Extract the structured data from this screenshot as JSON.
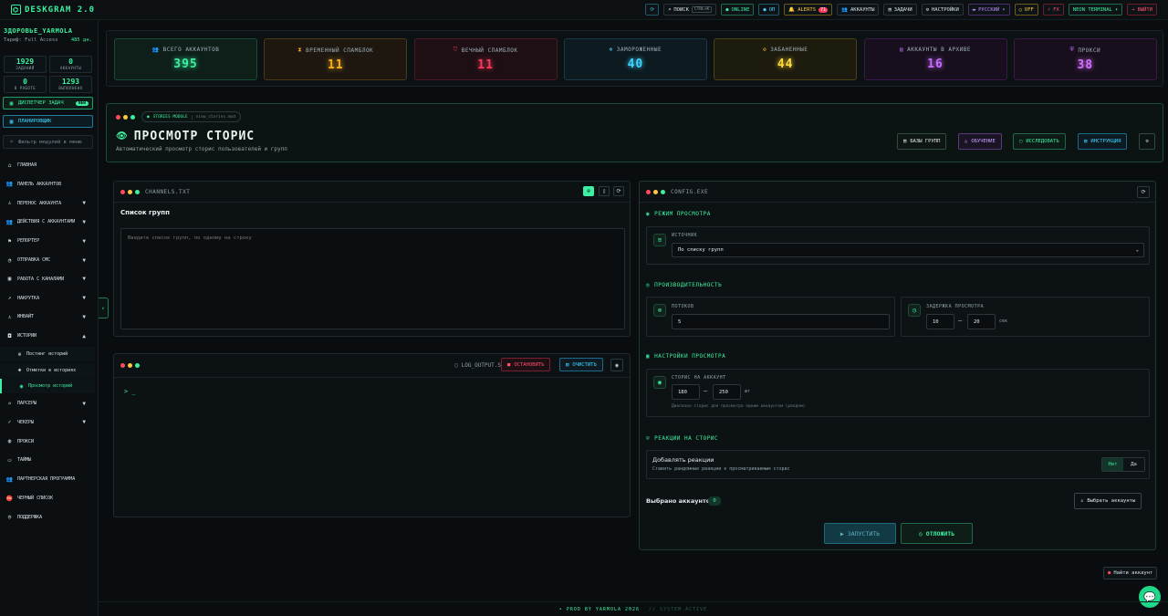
{
  "app": {
    "name": "DESKGRAM 2.0"
  },
  "topbar": {
    "search_label": "ПОИСК",
    "search_shortcut": "CTRL+K",
    "online_label": "ONLINE",
    "off_label": "ОП",
    "alerts_label": "ALERTS",
    "alerts_count": "71",
    "accounts_label": "АККАУНТЫ",
    "tasks_label": "ЗАДАЧИ",
    "settings_label": "НАСТРОЙКИ",
    "language_label": "РУССКИЙ",
    "mode_label": "OFF",
    "fx_label": "FX",
    "theme_label": "NEON TERMINAL",
    "logout_label": "ВЫЙТИ"
  },
  "sidebar": {
    "user_name": "ЗДОРОВЬЕ_YARMOLA",
    "tariff": "Тариф: Full Access",
    "balance": "485 дн.",
    "stats": [
      {
        "value": "1929",
        "label": "ЗАДАНИЙ"
      },
      {
        "value": "0",
        "label": "АККАУНТЫ"
      },
      {
        "value": "0",
        "label": "В РАБОТЕ"
      },
      {
        "value": "1293",
        "label": "ВЫПОЛНЕНО"
      }
    ],
    "task_manager": "ДИСПЕТЧЕР ЗАДАЧ",
    "task_manager_badge": "NEW",
    "scheduler": "ПЛАНИРОВЩИК",
    "filter_placeholder": "Фильтр модулей в меню",
    "nav": [
      {
        "label": "ГЛАВНАЯ",
        "icon": "home-icon",
        "chevron": ""
      },
      {
        "label": "ПАНЕЛЬ АККАУНТОВ",
        "icon": "users-icon",
        "chevron": ""
      },
      {
        "label": "ПЕРЕНОС АККАУНТА",
        "icon": "user-icon",
        "chevron": "▼"
      },
      {
        "label": "ДЕЙСТВИЯ С АККАУНТАМИ",
        "icon": "users-icon",
        "chevron": "▼"
      },
      {
        "label": "РЕПОРТЕР",
        "icon": "flag-icon",
        "chevron": "▼"
      },
      {
        "label": "ОТПРАВКА СМС",
        "icon": "chat-icon",
        "chevron": "▼"
      },
      {
        "label": "РАБОТА С КАНАЛАМИ",
        "icon": "channel-icon",
        "chevron": "▼"
      },
      {
        "label": "НАКРУТКА",
        "icon": "chart-icon",
        "chevron": "▼"
      },
      {
        "label": "ИНВАЙТ",
        "icon": "invite-icon",
        "chevron": "▼"
      },
      {
        "label": "ИСТОРИИ",
        "icon": "camera-icon",
        "chevron": "▲"
      }
    ],
    "sub_nav": [
      {
        "label": "Постинг историй",
        "icon": "plus-circle-icon"
      },
      {
        "label": "Отметки в историях",
        "icon": "tag-icon"
      },
      {
        "label": "Просмотр историй",
        "icon": "eye-icon"
      }
    ],
    "nav2": [
      {
        "label": "ПАРСЕРЫ",
        "icon": "search-icon",
        "chevron": "▼"
      },
      {
        "label": "ЧЕКЕРЫ",
        "icon": "check-icon",
        "chevron": "▼"
      },
      {
        "label": "ПРОКСИ",
        "icon": "globe-icon",
        "chevron": ""
      },
      {
        "label": "ТАЙМЫ",
        "icon": "clock-icon",
        "chevron": ""
      },
      {
        "label": "ПАРТНЕРСКАЯ ПРОГРАММА",
        "icon": "handshake-icon",
        "chevron": ""
      },
      {
        "label": "ЧЕРНЫЙ СПИСОК",
        "icon": "block-icon",
        "chevron": ""
      },
      {
        "label": "ПОДДЕРЖКА",
        "icon": "support-icon",
        "chevron": ""
      }
    ]
  },
  "stat_cards": [
    {
      "label": "ВСЕГО АККАУНТОВ",
      "value": "395",
      "color": "#3bf0a0",
      "bg": "#0e1f1a",
      "border": "#1a4a38",
      "icon": "👥"
    },
    {
      "label": "ВРЕМЕННЫЙ СПАМБЛОК",
      "value": "11",
      "color": "#ffb01a",
      "bg": "#1d1710",
      "border": "#4a3a1a",
      "icon": "⧗"
    },
    {
      "label": "ВЕЧНЫЙ СПАМБЛОК",
      "value": "11",
      "color": "#ff3a5c",
      "bg": "#1d0f14",
      "border": "#4a1a26",
      "icon": "⛉"
    },
    {
      "label": "ЗАМОРОЖЕННЫЕ",
      "value": "40",
      "color": "#3fd5ff",
      "bg": "#0d1a20",
      "border": "#1a3a4a",
      "icon": "❄"
    },
    {
      "label": "ЗАБАНЕННЫЕ",
      "value": "44",
      "color": "#ffd83c",
      "bg": "#1d1a0e",
      "border": "#4a421a",
      "icon": "⊘"
    },
    {
      "label": "АККАУНТЫ В АРХИВЕ",
      "value": "16",
      "color": "#c86cff",
      "bg": "#170f1d",
      "border": "#3a1a4a",
      "icon": "▤"
    },
    {
      "label": "ПРОКСИ",
      "value": "38",
      "color": "#d470ff",
      "bg": "#180f1c",
      "border": "#3a1a44",
      "icon": "⛨"
    }
  ],
  "hero": {
    "module_chip": "STORIES MODULE",
    "module_file": "view_stories.mod",
    "title": "ПРОСМОТР СТОРИС",
    "subtitle": "Автоматический просмотр сторис пользователей и групп",
    "btn_bases": "БАЗЫ ГРУПП",
    "btn_learn": "ОБУЧЕНИЕ",
    "btn_research": "ИССЛЕДОВАТЬ",
    "btn_instructions": "ИНСТРУКЦИЯ"
  },
  "channels": {
    "file": "CHANNELS.TXT",
    "heading": "Список групп",
    "placeholder": "Введите список групп, по одному на строку"
  },
  "log": {
    "file": "LOG_OUTPUT.SH",
    "stop": "ОСТАНОВИТЬ",
    "clear": "ОЧИСТИТЬ",
    "prompt": "> _"
  },
  "config": {
    "file": "CONFIG.EXE",
    "view_mode_title": "РЕЖИМ ПРОСМОТРА",
    "source_label": "ИСТОЧНИК",
    "source_value": "По списку групп",
    "perf_title": "ПРОИЗВОДИТЕЛЬНОСТЬ",
    "threads_label": "ПОТОКОВ",
    "threads_value": "5",
    "delay_label": "ЗАДЕРЖКА ПРОСМОТРА",
    "delay_from": "10",
    "delay_to": "20",
    "delay_unit": "сек",
    "view_settings_title": "НАСТРОЙКИ ПРОСМОТРА",
    "stories_label": "СТОРИС НА АККАУНТ",
    "stories_from": "180",
    "stories_to": "250",
    "stories_unit": "шт",
    "stories_hint": "Диапазон сторис для просмотра одним аккаунтом (рандом)",
    "reactions_title": "РЕАКЦИИ НА СТОРИС",
    "reactions_label": "Добавлять реакции",
    "reactions_hint": "Ставить рандомные реакции к просматриваемым сторис",
    "no": "Нет",
    "yes": "Да",
    "selected_label": "Выбрано аккаунтов:",
    "selected_count": "0",
    "select_accounts": "Выбрать аккаунты",
    "start": "ЗАПУСТИТЬ",
    "schedule": "ОТЛОЖИТЬ"
  },
  "hide_banner": "Найти аккаунт",
  "footer": {
    "prod": "• PROD BY YARMOLA 2026",
    "status": "// SYSTEM ACTIVE"
  }
}
